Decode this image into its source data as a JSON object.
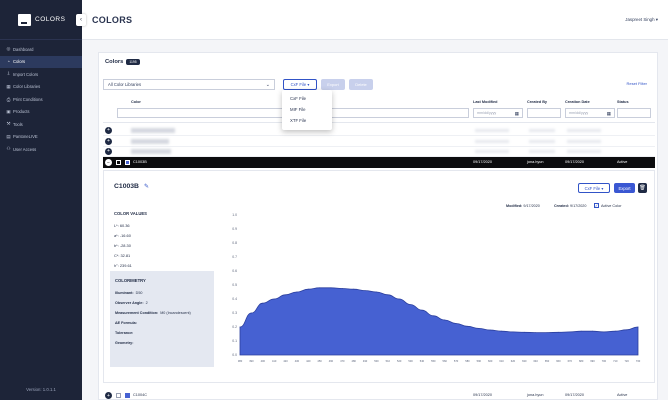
{
  "brand": {
    "name": "COLORS"
  },
  "topbar": {
    "title": "COLORS",
    "user": "Jaspreet Singh ▾"
  },
  "sidebar": {
    "items": [
      {
        "label": "Dashboard",
        "icon": "dashboard-icon",
        "glyph": "◎"
      },
      {
        "label": "Colors",
        "icon": "palette-icon",
        "glyph": "◔"
      },
      {
        "label": "Import Colors",
        "icon": "import-icon",
        "glyph": "⇩"
      },
      {
        "label": "Color Libraries",
        "icon": "library-icon",
        "glyph": "▦"
      },
      {
        "label": "Print Conditions",
        "icon": "printer-icon",
        "glyph": "⎙"
      },
      {
        "label": "Products",
        "icon": "products-icon",
        "glyph": "▣"
      },
      {
        "label": "Tools",
        "icon": "wrench-icon",
        "glyph": "⚒"
      },
      {
        "label": "PantoneLIVE",
        "icon": "pantone-icon",
        "glyph": "▤"
      },
      {
        "label": "User Access",
        "icon": "user-access-icon",
        "glyph": "⚇"
      }
    ],
    "version": "Version: 1.0.1.1"
  },
  "colors_panel": {
    "title": "Colors",
    "count": "1195",
    "library_select": "All Color Libraries",
    "cxf_button": "CxF File ▾",
    "export_button": "Export",
    "delete_button": "Delete",
    "reset_filter": "Reset Filter",
    "file_menu": [
      "CxF File",
      "MIF File",
      "XTF File"
    ]
  },
  "table": {
    "headers": {
      "color": "Color",
      "last_modified": "Last Modified",
      "created_by": "Created By",
      "creation_date": "Creation Date",
      "status": "Status"
    },
    "date_placeholder": "mm/dd/yyyy",
    "selected_row": {
      "name": "C1003B",
      "last_modified": "09/17/2020",
      "created_by": "jona.hyun",
      "creation_date": "09/17/2020",
      "status": "Active"
    },
    "bottom_row": {
      "name": "C1004C",
      "last_modified": "09/17/2020",
      "created_by": "jona.hyun",
      "creation_date": "09/17/2020",
      "status": "Active"
    }
  },
  "detail": {
    "name": "C1003B",
    "cxf_button": "CxF File ▾",
    "export_button": "Export",
    "modified_label": "Modified:",
    "modified": "9/17/2020",
    "created_label": "Created:",
    "created": "9/17/2020",
    "active_label": "Active Color",
    "color_values_title": "COLOR VALUES",
    "color_values": [
      "L*: 60.36",
      "a*: -16.60",
      "b*: -28.30",
      "C*: 32.81",
      "h°: 239.61"
    ],
    "colorimetry_title": "COLORIMETRY",
    "colorimetry": [
      {
        "label": "Illuminant:",
        "value": "D50"
      },
      {
        "label": "Observer Angle:",
        "value": "2"
      },
      {
        "label": "Measurement Condition:",
        "value": "M0 (Incandescent)"
      },
      {
        "label": "ΔE Formula:",
        "value": ""
      },
      {
        "label": "Tolerance:",
        "value": ""
      },
      {
        "label": "Geometry:",
        "value": ""
      }
    ]
  },
  "colors": {
    "accent": "#3153c7",
    "sidebar": "#1d2438",
    "curve_fill": "#4661d2"
  },
  "chart_data": {
    "type": "area",
    "x": [
      380,
      390,
      400,
      410,
      420,
      430,
      440,
      450,
      460,
      470,
      480,
      490,
      500,
      510,
      520,
      530,
      540,
      550,
      560,
      570,
      580,
      590,
      600,
      610,
      620,
      630,
      640,
      650,
      660,
      670,
      680,
      690,
      700,
      710,
      720,
      730
    ],
    "values": [
      0.2,
      0.3,
      0.37,
      0.4,
      0.43,
      0.45,
      0.47,
      0.48,
      0.48,
      0.475,
      0.47,
      0.46,
      0.45,
      0.43,
      0.4,
      0.36,
      0.32,
      0.28,
      0.25,
      0.225,
      0.205,
      0.19,
      0.178,
      0.17,
      0.165,
      0.162,
      0.16,
      0.16,
      0.162,
      0.165,
      0.17,
      0.17,
      0.165,
      0.17,
      0.18,
      0.2
    ],
    "yticks": [
      "1.0",
      "0.9",
      "0.8",
      "0.7",
      "0.6",
      "0.5",
      "0.4",
      "0.3",
      "0.2",
      "0.1",
      "0.0"
    ],
    "ylim": [
      0,
      1
    ],
    "grid": false
  }
}
